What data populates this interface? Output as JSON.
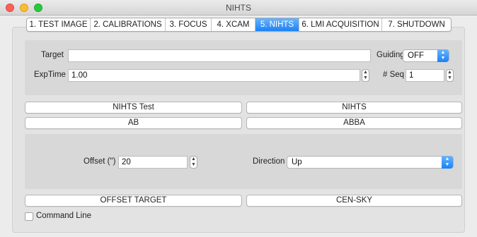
{
  "window": {
    "title": "NIHTS"
  },
  "tabs": [
    {
      "label": "1. TEST IMAGE"
    },
    {
      "label": "2. CALIBRATIONS"
    },
    {
      "label": "3. FOCUS"
    },
    {
      "label": "4. XCAM"
    },
    {
      "label": "5. NIHTS",
      "active": true
    },
    {
      "label": "6. LMI ACQUISITION"
    },
    {
      "label": "7. SHUTDOWN"
    }
  ],
  "target_panel": {
    "target_label": "Target",
    "target_value": "",
    "guiding_label": "Guiding",
    "guiding_value": "OFF",
    "exptime_label": "ExpTime",
    "exptime_value": "1.00",
    "seq_label": "# Seq",
    "seq_value": "1"
  },
  "buttons": {
    "nihts_test": "NIHTS Test",
    "nihts": "NIHTS",
    "ab": "AB",
    "abba": "ABBA",
    "offset_target": "OFFSET TARGET",
    "cen_sky": "CEN-SKY"
  },
  "offset_panel": {
    "offset_label": "Offset (\")",
    "offset_value": "20",
    "direction_label": "Direction",
    "direction_value": "Up"
  },
  "command_line": {
    "label": "Command Line",
    "checked": false
  },
  "colors": {
    "accent": "#1a82f7",
    "panel": "#d8d8d8",
    "background": "#ececec"
  }
}
